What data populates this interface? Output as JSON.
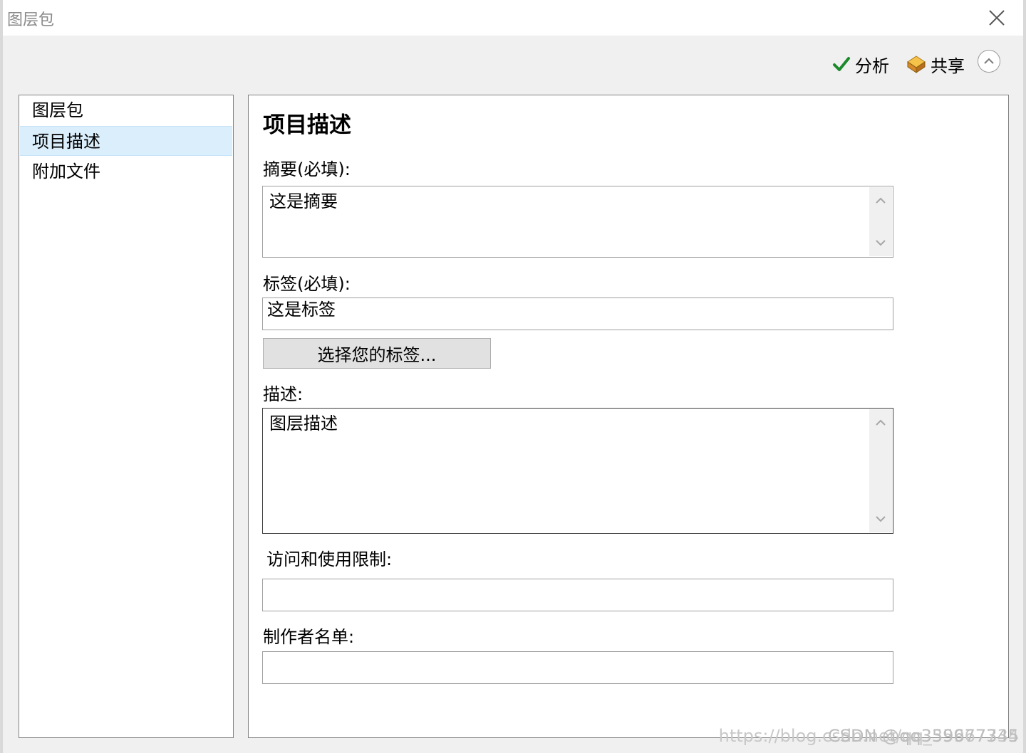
{
  "window": {
    "title": "图层包"
  },
  "toolbar": {
    "analyze_label": "分析",
    "share_label": "共享"
  },
  "nav": {
    "items": [
      {
        "label": "图层包"
      },
      {
        "label": "项目描述"
      },
      {
        "label": "附加文件"
      }
    ],
    "selected": "项目描述"
  },
  "form": {
    "section_title": "项目描述",
    "summary_label": "摘要(必填):",
    "summary_value": "这是摘要",
    "tags_label": "标签(必填):",
    "tags_value": "这是标签",
    "choose_tags_button": "选择您的标签...",
    "description_label": "描述:",
    "description_value": "图层描述",
    "access_label": "访问和使用限制:",
    "access_value": "",
    "credits_label": "制作者名单:",
    "credits_value": ""
  },
  "watermark": {
    "text_back": "https://blog.csdn.net/qq_35967734",
    "text_front": "CSDN @qq359677345"
  },
  "colors": {
    "selection": "#dbeefb",
    "check": "#1a8a2a",
    "share": "#e8a33a"
  }
}
